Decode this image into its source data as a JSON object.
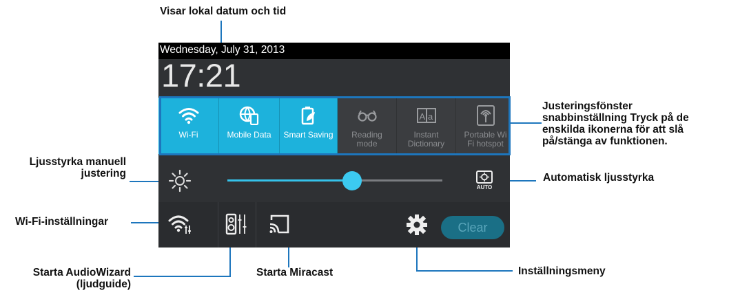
{
  "callouts": {
    "date_time": "Visar lokal datum och tid",
    "quick_settings_line1": "Justeringsfönster",
    "quick_settings_line2": "snabbinställning Tryck på de",
    "quick_settings_line3": "enskilda ikonerna för att slå",
    "quick_settings_line4": "på/stänga av funktionen.",
    "brightness_manual_line1": "Ljusstyrka manuell",
    "brightness_manual_line2": "justering",
    "auto_brightness": "Automatisk ljusstyrka",
    "wifi_settings": "Wi-Fi-inställningar",
    "audiowizard_line1": "Starta AudioWizard",
    "audiowizard_line2": "(ljudguide)",
    "miracast": "Starta Miracast",
    "settings_menu": "Inställningsmeny"
  },
  "device": {
    "date": "Wednesday, July 31, 2013",
    "time": "17:21",
    "tiles": [
      {
        "label": "Wi-Fi",
        "state": "on",
        "icon": "wifi-icon"
      },
      {
        "label": "Mobile Data",
        "state": "on",
        "icon": "mobile-data-icon"
      },
      {
        "label": "Smart Saving",
        "state": "on",
        "icon": "smart-saving-icon"
      },
      {
        "label": "Reading\nmode",
        "state": "off",
        "icon": "reading-mode-icon"
      },
      {
        "label": "Instant\nDictionary",
        "state": "off",
        "icon": "instant-dictionary-icon"
      },
      {
        "label": "Portable Wi\nFi hotspot",
        "state": "off",
        "icon": "hotspot-icon"
      }
    ],
    "brightness_level": 0.58,
    "auto_brightness_badge": "AUTO",
    "clear_label": "Clear"
  },
  "colors": {
    "accent": "#1db2dc",
    "callout_line": "#1d76bd",
    "panel": "#2f3134"
  }
}
